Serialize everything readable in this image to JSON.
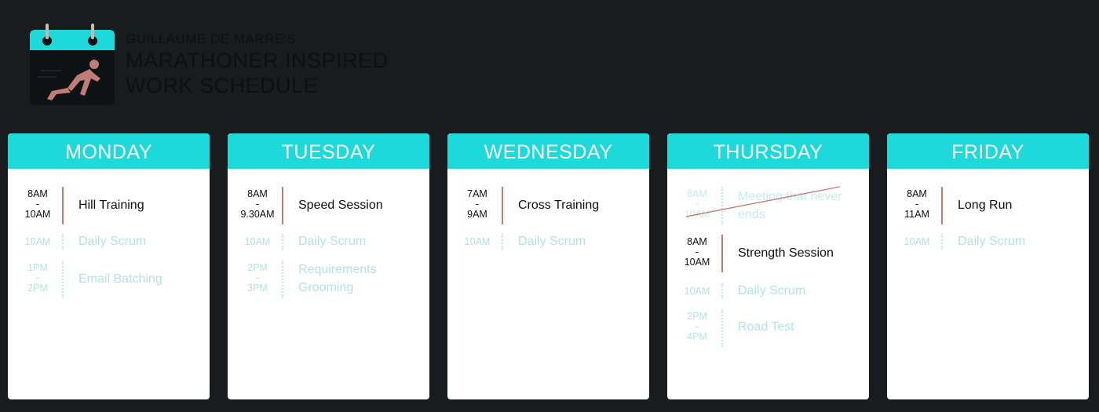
{
  "header": {
    "author": "GUILLAUME DE MARRE'S",
    "title_line1": "MARATHONER INSPIRED",
    "title_line2": "WORK SCHEDULE"
  },
  "colors": {
    "background": "#181c1e",
    "accent": "#1ed9d9",
    "major_divider": "#c17c76",
    "minor_text": "#b4e2e4"
  },
  "days": [
    {
      "name": "MONDAY",
      "events": [
        {
          "start": "8AM",
          "sep": "-",
          "end": "10AM",
          "title": "Hill Training"
        },
        {
          "time": "10AM",
          "title": "Daily Scrum"
        },
        {
          "start": "1PM",
          "sep": "-",
          "end": "2PM",
          "title": "Email Batching"
        }
      ]
    },
    {
      "name": "TUESDAY",
      "events": [
        {
          "start": "8AM",
          "sep": "-",
          "end": "9.30AM",
          "title": "Speed Session"
        },
        {
          "time": "10AM",
          "title": "Daily Scrum"
        },
        {
          "start": "2PM",
          "sep": "-",
          "end": "3PM",
          "title_line1": "Requirements",
          "title_line2": "Grooming"
        }
      ]
    },
    {
      "name": "WEDNESDAY",
      "events": [
        {
          "start": "7AM",
          "sep": "-",
          "end": "9AM",
          "title": "Cross Training"
        },
        {
          "time": "10AM",
          "title": "Daily Scrum"
        }
      ]
    },
    {
      "name": "THURSDAY",
      "events": [
        {
          "start": "8AM",
          "sep": "-",
          "end": "10AM",
          "title_line1": "Meeting that never",
          "title_line2": "ends"
        },
        {
          "start": "8AM",
          "sep": "-",
          "end": "10AM",
          "title": "Strength Session"
        },
        {
          "time": "10AM",
          "title": "Daily Scrum"
        },
        {
          "start": "2PM",
          "sep": "-",
          "end": "4PM",
          "title": "Road Test"
        }
      ]
    },
    {
      "name": "FRIDAY",
      "events": [
        {
          "start": "8AM",
          "sep": "-",
          "end": "11AM",
          "title": "Long Run"
        },
        {
          "time": "10AM",
          "title": "Daily Scrum"
        }
      ]
    }
  ]
}
